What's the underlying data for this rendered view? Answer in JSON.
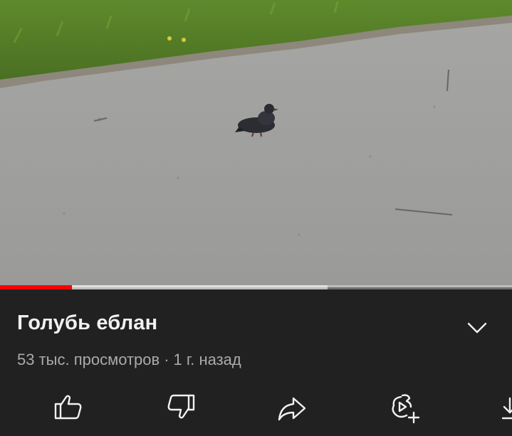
{
  "video": {
    "title": "Голубь еблан",
    "views": "53 тыс. просмотров",
    "separator": "·",
    "age": "1 г. назад",
    "progress_fraction": 0.14,
    "buffered_fraction": 0.64
  },
  "icons": {
    "expand": "chevron-down-icon",
    "like": "thumbs-up-icon",
    "dislike": "thumbs-down-icon",
    "share": "share-icon",
    "remix": "remix-icon",
    "download": "download-icon"
  },
  "colors": {
    "background": "#212121",
    "progress": "#ff0000",
    "title": "#f1f1f1",
    "meta": "#aaaaaa"
  }
}
